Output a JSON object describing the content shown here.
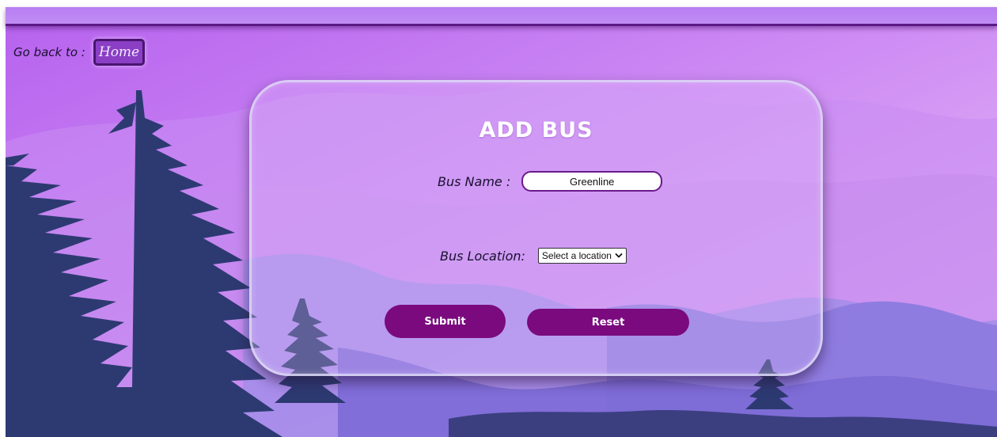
{
  "nav": {
    "go_back_label": "Go back to :",
    "home_label": "Home"
  },
  "form": {
    "title": "ADD BUS",
    "bus_name_label": "Bus Name :",
    "bus_name_value": "Greenline",
    "bus_location_label": "Bus Location:",
    "bus_location_selected": "Select a location",
    "submit_label": "Submit",
    "reset_label": "Reset"
  },
  "icons": {
    "select_arrow": "chevron-down-icon"
  },
  "colors": {
    "button_primary": "#7a0a7e",
    "home_button": "#8a3fc4",
    "sky_top": "#b565ef",
    "sky_bottom": "#e6b8f6",
    "mountain": "#8f7fe0",
    "tree": "#2d3a72"
  }
}
